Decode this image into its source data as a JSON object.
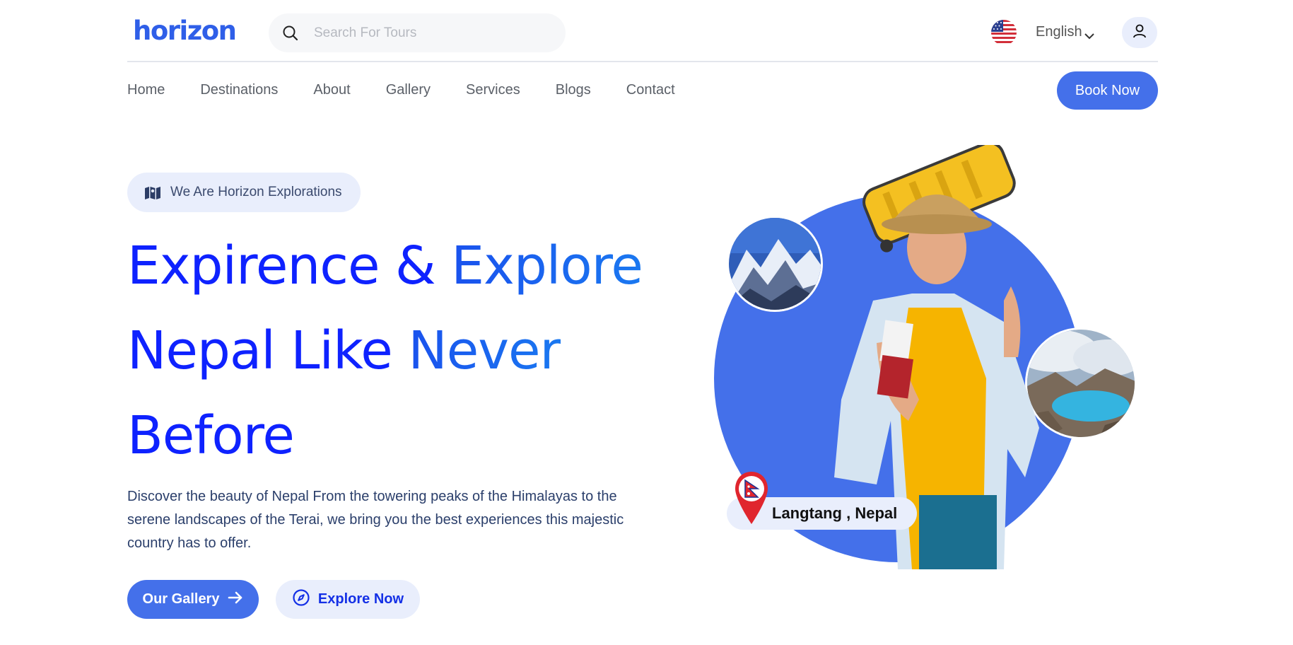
{
  "brand": {
    "logo_text": "horizon",
    "accent": "#4470ea",
    "title_color": "#0e22ff"
  },
  "search": {
    "placeholder": "Search For Tours",
    "icon": "search-icon"
  },
  "language": {
    "selected": "English",
    "flag": "us-flag-icon"
  },
  "user": {
    "icon": "user-icon"
  },
  "nav": {
    "items": [
      "Home",
      "Destinations",
      "About",
      "Gallery",
      "Services",
      "Blogs",
      "Contact"
    ],
    "cta": "Book Now"
  },
  "hero": {
    "tag": "We Are Horizon Explorations",
    "title_lines": [
      "Expirence & Explore",
      "Nepal Like Never",
      "Before"
    ],
    "title_parts": {
      "l1a": "Expirence & ",
      "l1b": "Explore",
      "l2a": "Nepal Like ",
      "l2b": "Never",
      "l3": "Before"
    },
    "description": "Discover the beauty of Nepal From the towering peaks of the Himalayas to the serene landscapes of the Terai, we bring you the best experiences this majestic country has to offer.",
    "buttons": {
      "gallery": "Our Gallery",
      "explore": "Explore Now"
    }
  },
  "location": {
    "label": "Langtang , Nepal",
    "icon": "nepal-flag-pin-icon"
  }
}
